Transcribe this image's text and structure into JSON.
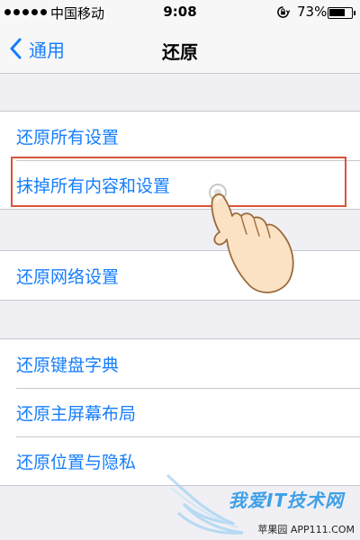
{
  "status_bar": {
    "carrier": "中国移动",
    "time": "9:08",
    "battery_percent_text": "73%",
    "battery_level": 0.73
  },
  "nav": {
    "back_label": "通用",
    "title": "还原"
  },
  "groups": [
    {
      "items": [
        "还原所有设置",
        "抹掉所有内容和设置"
      ]
    },
    {
      "items": [
        "还原网络设置"
      ]
    },
    {
      "items": [
        "还原键盘字典",
        "还原主屏幕布局",
        "还原位置与隐私"
      ]
    }
  ],
  "highlighted_item": "抹掉所有内容和设置",
  "watermark": {
    "brand": "我爱IT技术网",
    "site": "苹果园 APP111.COM"
  },
  "colors": {
    "accent": "#157efb",
    "highlight": "#d9533a",
    "background": "#efeff4"
  }
}
